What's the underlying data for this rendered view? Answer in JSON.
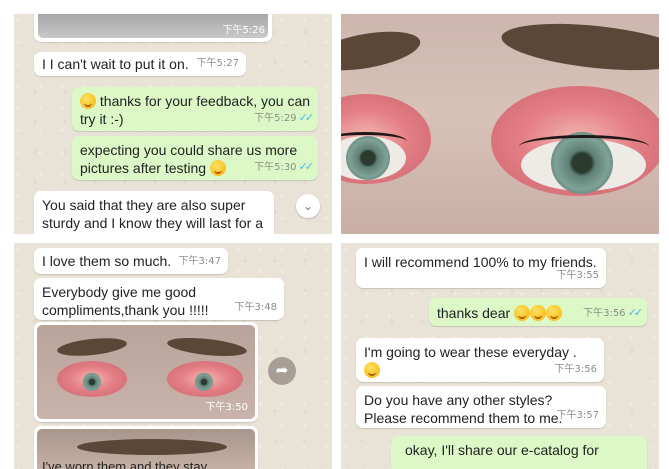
{
  "top_left": {
    "photo_time": "下午5:26",
    "messages": [
      {
        "text": "I I can't wait to put it on.",
        "time": "下午5:27"
      },
      {
        "text": "thanks for your feedback, you can try it :-)",
        "time": "下午5:29"
      },
      {
        "text": "expecting you could share us more pictures after testing",
        "time": "下午5:30"
      },
      {
        "text": "You said that they are also super sturdy and I know they will last for a long time. These work best on a"
      }
    ],
    "scroll_icon": "chevron-down-icon"
  },
  "top_right": {
    "photo_label": "eye-makeup-closeup"
  },
  "bottom_left": {
    "messages": [
      {
        "text": "I love them so much.",
        "time": "下午3:47"
      },
      {
        "text": "Everybody give me good compliments,thank you !!!!!",
        "time": "下午3:48"
      }
    ],
    "photo_time": "下午3:50",
    "share_icon": "share-arrow-icon",
    "bottom_fragment": "I've worn them and they stay"
  },
  "bottom_right": {
    "messages": [
      {
        "text": "I will recommend 100% to my friends.",
        "time": "下午3:55"
      },
      {
        "text": "thanks dear",
        "time": "下午3:56"
      },
      {
        "text": "I'm going to wear these everyday .",
        "time": "下午3:56"
      },
      {
        "text": "Do you have any other styles? Please recommend them to me.",
        "time": "下午3:57"
      },
      {
        "text": "okay, I'll share our e-catalog for",
        "time": ""
      }
    ]
  },
  "colors": {
    "incoming": "#ffffff",
    "outgoing": "#dcf8c6",
    "read_tick": "#4fb6ec"
  }
}
